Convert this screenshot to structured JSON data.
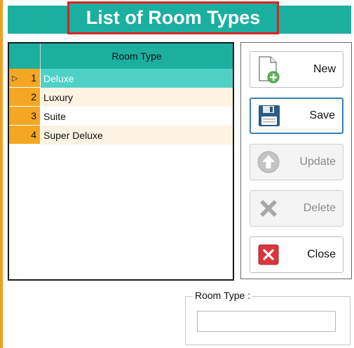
{
  "header": {
    "title": "List of Room Types"
  },
  "grid": {
    "column_header": "Room Type",
    "rows": [
      {
        "index": "1",
        "room_type": "Deluxe"
      },
      {
        "index": "2",
        "room_type": "Luxury"
      },
      {
        "index": "3",
        "room_type": "Suite"
      },
      {
        "index": "4",
        "room_type": "Super Deluxe"
      }
    ]
  },
  "buttons": {
    "new_label": "New",
    "save_label": "Save",
    "update_label": "Update",
    "delete_label": "Delete",
    "close_label": "Close"
  },
  "form": {
    "room_type_label": "Room Type :",
    "room_type_value": ""
  },
  "colors": {
    "header_teal": "#1bafa0",
    "selected_row": "#4fd1c8",
    "indicator_orange": "#f5a623",
    "title_border": "#e02020"
  }
}
